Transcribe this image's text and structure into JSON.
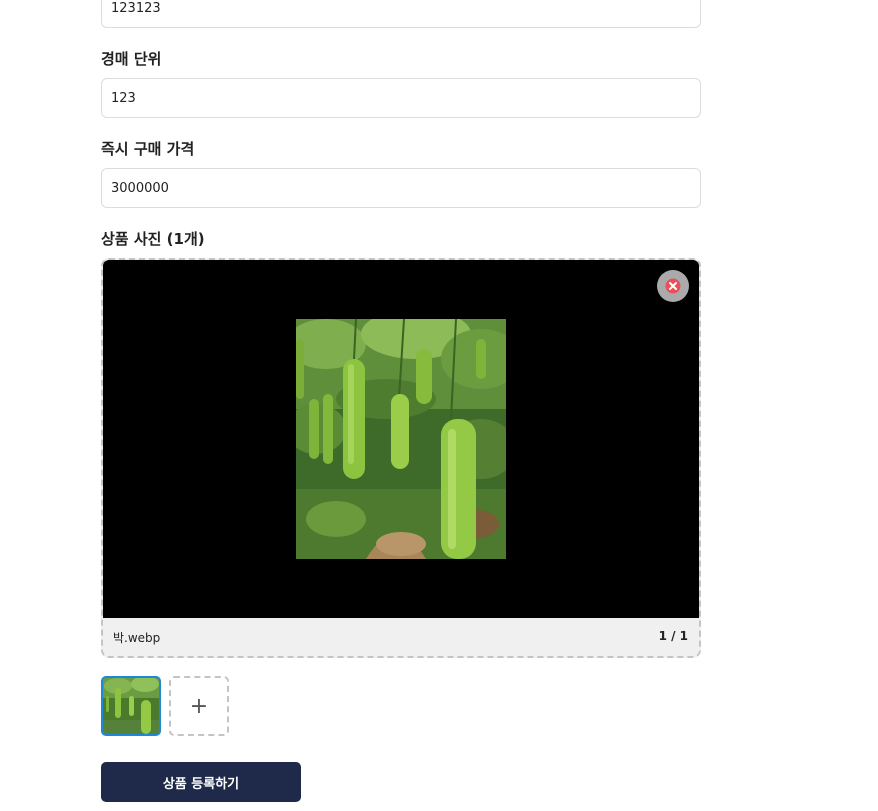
{
  "fields": {
    "reserve_price": {
      "value": "123123"
    },
    "bid_unit": {
      "label": "경매 단위",
      "value": "123"
    },
    "buy_now_price": {
      "label": "즉시 구매 가격",
      "value": "3000000"
    }
  },
  "photos": {
    "label": "상품 사진",
    "count_text": "(1개)",
    "file_name": "박.webp",
    "pager": "1 / 1",
    "remove_icon": "close-circle-icon",
    "add_icon": "plus-icon",
    "add_label": "+"
  },
  "submit": {
    "label": "상품 등록하기"
  },
  "colors": {
    "accent": "#1e88d8",
    "submit_bg": "#1f2a4a",
    "remove_icon": "#e8505b"
  }
}
